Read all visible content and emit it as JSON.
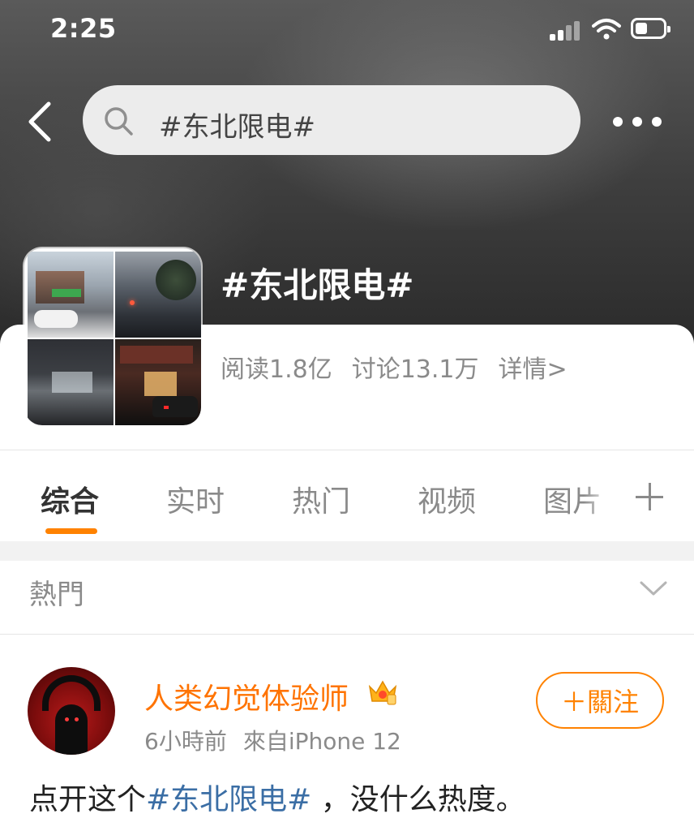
{
  "status_bar": {
    "time": "2:25"
  },
  "search": {
    "query": "#东北限电#"
  },
  "topic": {
    "title": "#东北限电#",
    "reads": "阅读1.8亿",
    "discussions": "讨论13.1万",
    "details": "详情>"
  },
  "tabs": [
    {
      "label": "综合",
      "active": true
    },
    {
      "label": "实时"
    },
    {
      "label": "热门"
    },
    {
      "label": "视频"
    },
    {
      "label": "图片"
    }
  ],
  "filter": {
    "label": "熱門"
  },
  "post": {
    "username": "人类幻觉体验师",
    "time": "6小時前",
    "source": "來自iPhone 12",
    "follow_label": "＋關注",
    "text_before": "点开这个",
    "hashtag": "#东北限电#",
    "text_after": " ，没什么热度。"
  },
  "colors": {
    "accent": "#ff8200",
    "username": "#ff7300",
    "hashtag": "#3b6ea5"
  }
}
